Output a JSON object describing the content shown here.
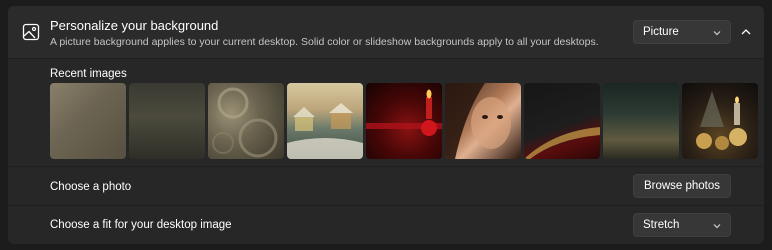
{
  "background_setting": {
    "title": "Personalize your background",
    "subtitle": "A picture background applies to your current desktop. Solid color or slideshow backgrounds apply to all your desktops.",
    "type_dropdown": {
      "value": "Picture"
    },
    "icon": "image-icon",
    "collapse_icon": "chevron-up-icon"
  },
  "recent_images": {
    "label": "Recent images",
    "items": [
      "brushed-metal-texture",
      "dark-olive-gradient",
      "abstract-swirls",
      "winter-village-painting",
      "red-candle-gift",
      "woman-portrait",
      "dark-red-curve",
      "dark-gold-gradient",
      "christmas-ornaments"
    ]
  },
  "photo_row": {
    "label": "Choose a photo",
    "button": "Browse photos"
  },
  "fit_row": {
    "label": "Choose a fit for your desktop image",
    "dropdown": {
      "value": "Stretch"
    }
  },
  "colors": {
    "card": "#272727",
    "header": "#2b2b2b",
    "control": "#373737"
  }
}
